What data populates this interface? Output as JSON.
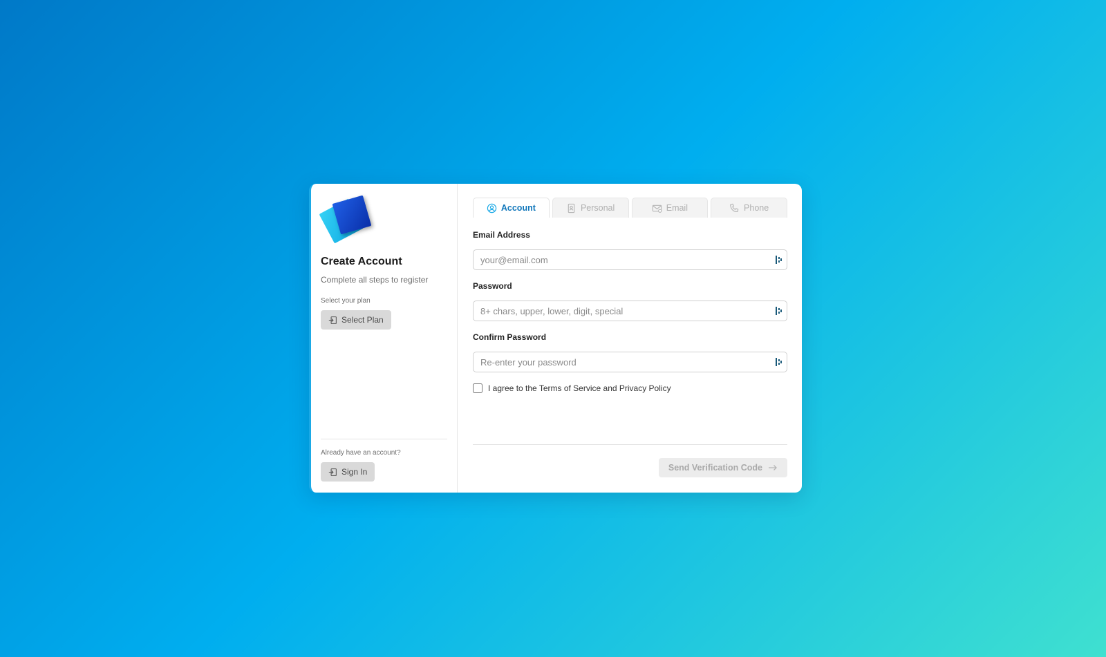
{
  "sidebar": {
    "title": "Create Account",
    "subtitle": "Complete all steps to register",
    "plan_label": "Select your plan",
    "plan_button": "Select Plan",
    "account_prompt": "Already have an account?",
    "signin_button": "Sign In"
  },
  "tabs": [
    {
      "label": "Account",
      "icon": "user-circle-icon",
      "active": true
    },
    {
      "label": "Personal",
      "icon": "id-card-icon",
      "active": false
    },
    {
      "label": "Email",
      "icon": "mail-icon",
      "active": false
    },
    {
      "label": "Phone",
      "icon": "phone-icon",
      "active": false
    }
  ],
  "form": {
    "email": {
      "label": "Email Address",
      "value": "",
      "placeholder": "your@email.com"
    },
    "password": {
      "label": "Password",
      "value": "",
      "placeholder": "8+ chars, upper, lower, digit, special"
    },
    "confirm": {
      "label": "Confirm Password",
      "value": "",
      "placeholder": "Re-enter your password"
    },
    "terms": {
      "label": "I agree to the Terms of Service and Privacy Policy",
      "checked": false
    }
  },
  "footer": {
    "send_button": "Send Verification Code"
  },
  "colors": {
    "accent": "#1177bb",
    "background_start": "#0079c8",
    "background_end": "#3fe0d0",
    "disabled_button": "#ececec"
  }
}
